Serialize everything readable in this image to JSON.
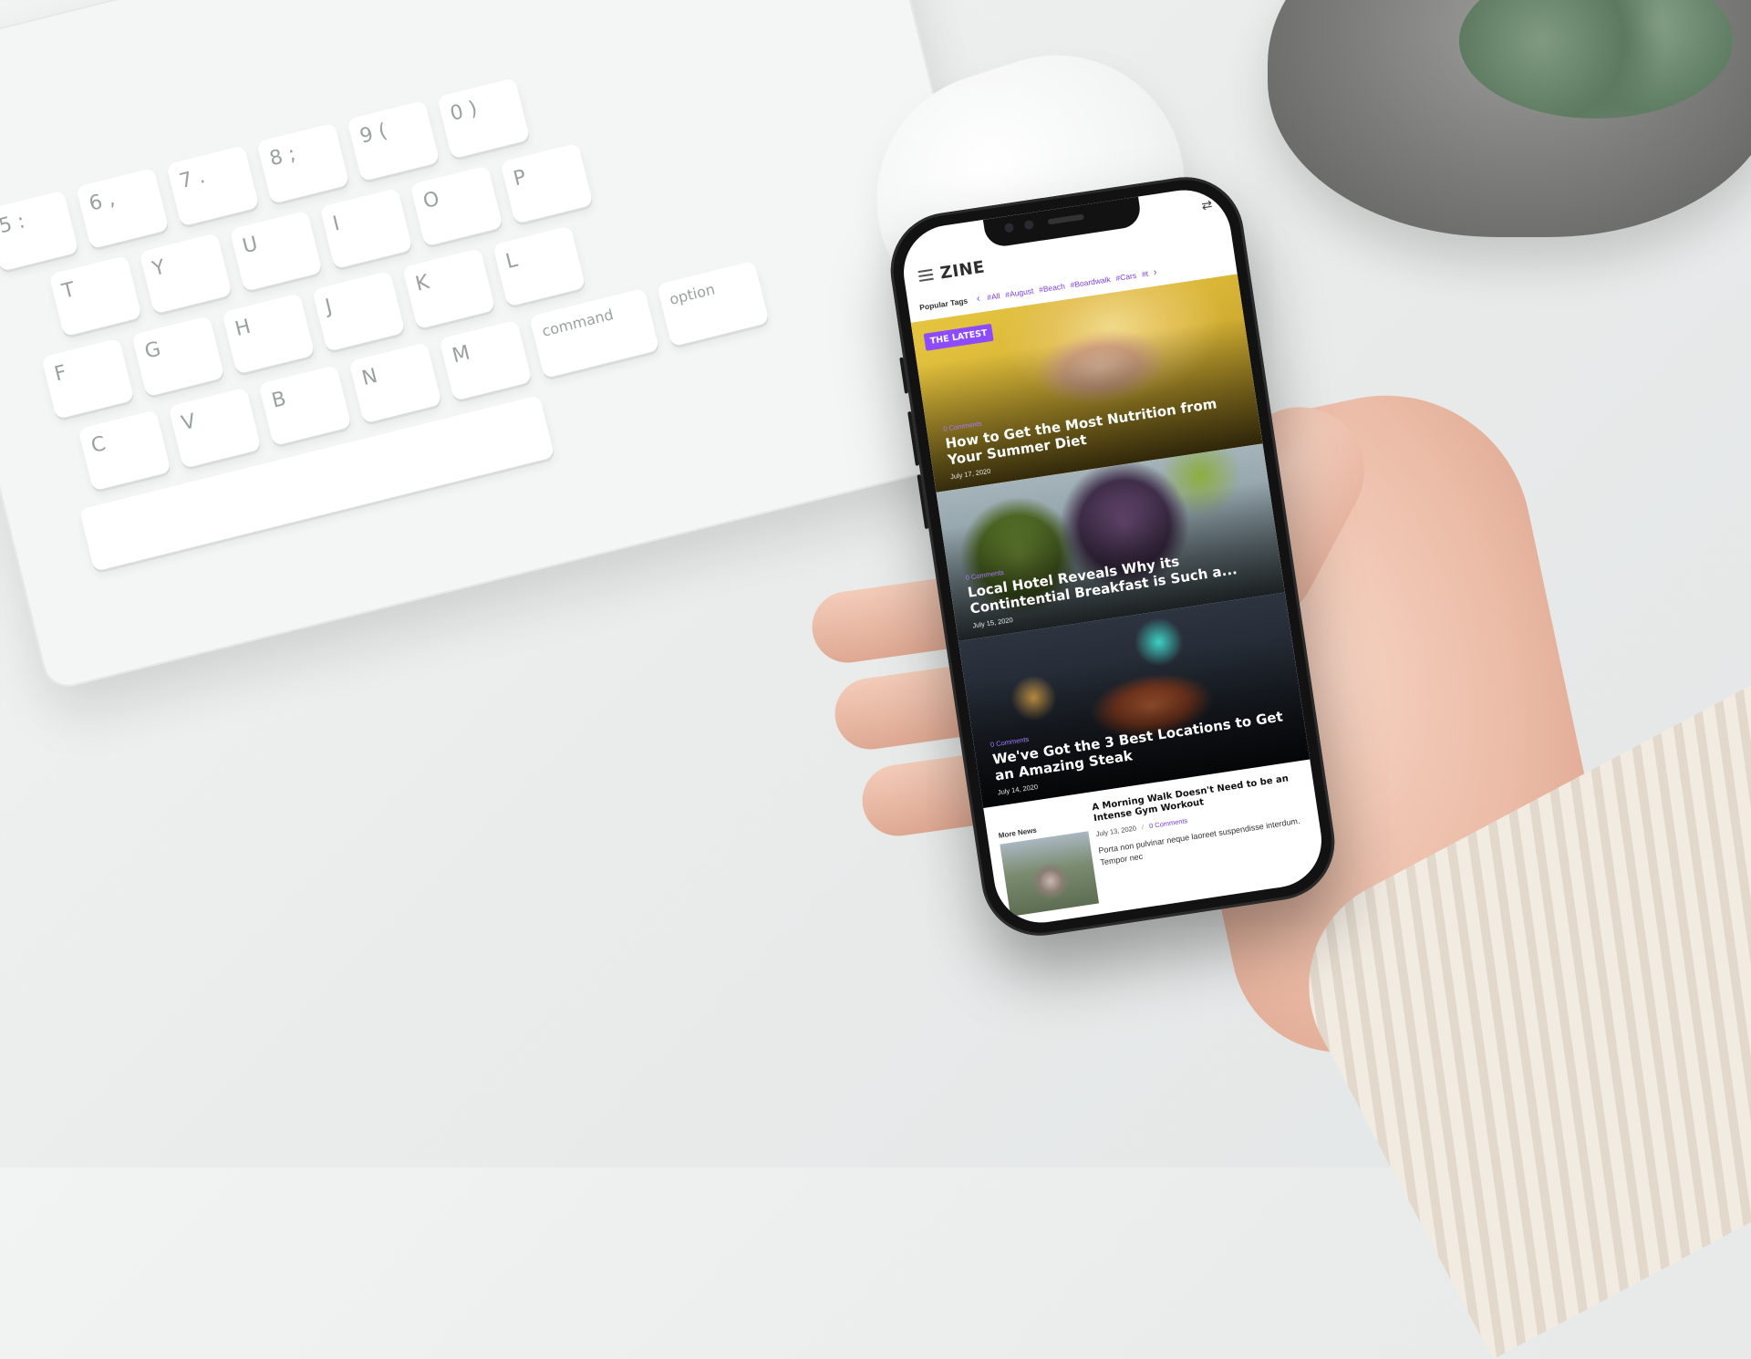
{
  "app": {
    "logo": "ZINE"
  },
  "tags": {
    "label": "Popular Tags",
    "items": [
      "#All",
      "#August",
      "#Beach",
      "#Boardwalk",
      "#Cars",
      "#t"
    ]
  },
  "featured": {
    "badge": "THE LATEST",
    "posts": [
      {
        "comments": "0 Comments",
        "title": "How to Get the Most Nutrition from Your Summer Diet",
        "date": "July 17, 2020"
      },
      {
        "comments": "0 Comments",
        "title": "Local Hotel Reveals Why its Contintential Breakfast is Such a...",
        "date": "July 15, 2020"
      },
      {
        "comments": "0 Comments",
        "title": "We've Got the 3 Best Locations to Get an Amazing Steak",
        "date": "July 14, 2020"
      }
    ]
  },
  "more_news": {
    "label": "More News",
    "item": {
      "title": "A Morning Walk Doesn't Need to be an Intense Gym Workout",
      "date": "July 13, 2020",
      "separator": "/",
      "comments": "0 Comments",
      "excerpt": "Porta non pulvinar neque laoreet suspendisse interdum. Tempor nec"
    }
  },
  "keyboard": {
    "keys": [
      "5 :",
      "6 ,",
      "7 .",
      "8 ;",
      "9 (",
      "0 )",
      "T",
      "Y",
      "U",
      "I",
      "O",
      "P",
      "F",
      "G",
      "H",
      "J",
      "K",
      "L",
      "C",
      "V",
      "B",
      "N",
      "M",
      "command",
      "option"
    ]
  },
  "colors": {
    "accent": "#7b3fe4",
    "badge": "#8d4bff"
  },
  "icons": {
    "menu": "menu-icon",
    "shuffle": "shuffle-icon",
    "arrow_left": "chevron-left-icon",
    "arrow_right": "chevron-right-icon"
  }
}
